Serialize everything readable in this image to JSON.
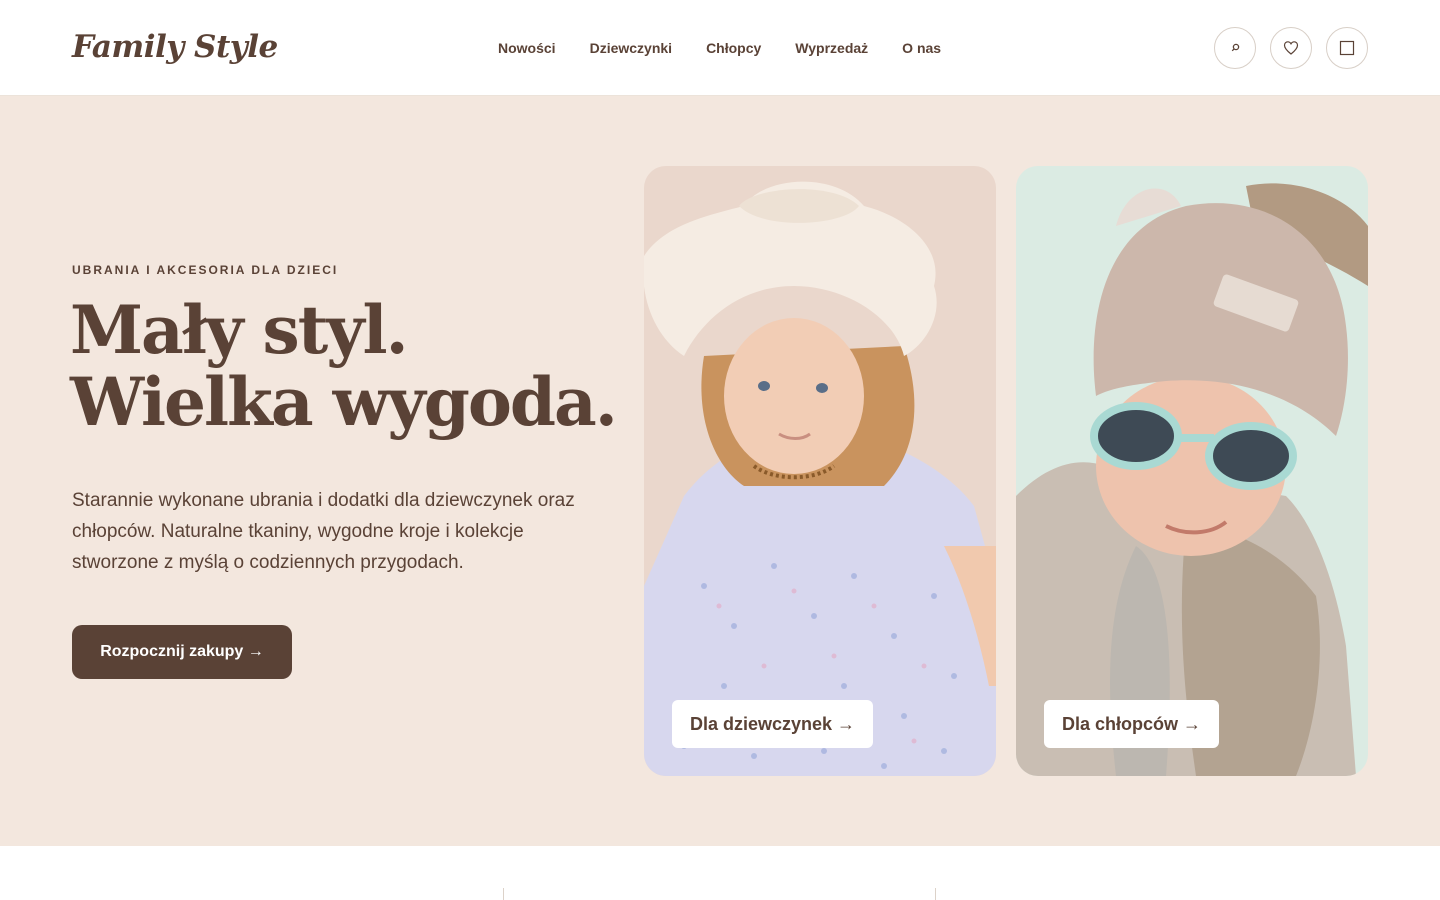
{
  "brand": {
    "name": "Family Style"
  },
  "nav": {
    "items": [
      "Nowości",
      "Dziewczynki",
      "Chłopcy",
      "Wyprzedaż",
      "O nas"
    ]
  },
  "header_icons": [
    "search-icon",
    "heart-icon",
    "bag-icon"
  ],
  "hero": {
    "eyebrow": "UBRANIA I AKCESORIA DLA DZIECI",
    "headline_line1": "Mały styl.",
    "headline_line2": "Wielka wygoda.",
    "lead": "Starannie wykonane ubrania i dodatki dla dziewczynek oraz chłopców. Naturalne tkaniny, wygodne kroje i kolekcje stworzone z myślą o codziennych przygodach.",
    "cta": "Rozpocznij zakupy →"
  },
  "cards": {
    "girls": {
      "label": "Dla dziewczynek →"
    },
    "boys": {
      "label": "Dla chłopców →"
    }
  },
  "colors": {
    "brand_brown": "#5a4236",
    "hero_bg": "#f3e7de",
    "girls_card_bg": "#ead7cc",
    "boys_card_bg": "#dbebe3"
  }
}
